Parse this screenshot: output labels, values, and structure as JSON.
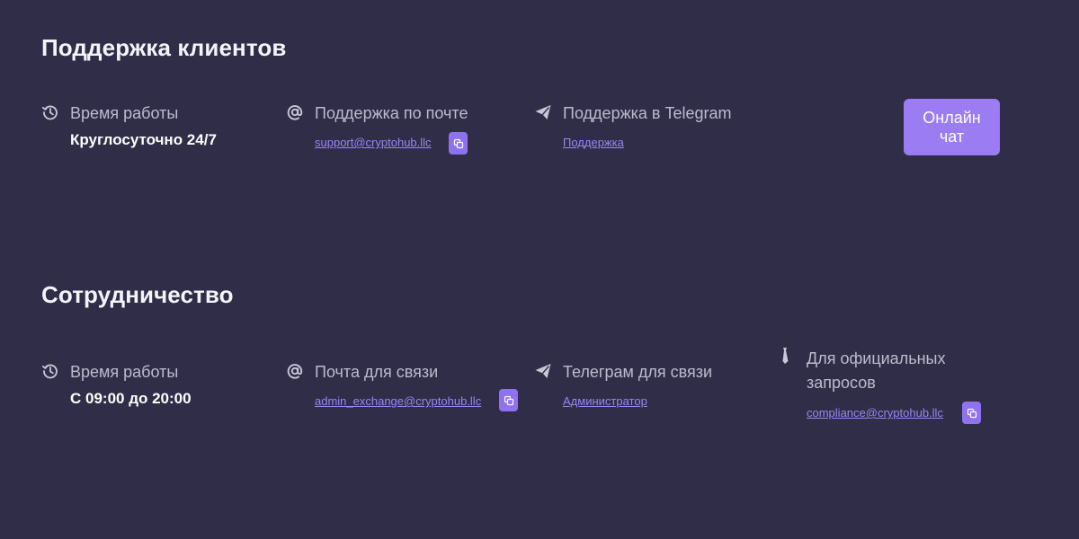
{
  "support": {
    "title": "Поддержка клиентов",
    "hours_label": "Время работы",
    "hours_value": "Круглосуточно 24/7",
    "email_label": "Поддержка по почте",
    "email_link": "support@cryptohub.llc",
    "telegram_label": "Поддержка в Telegram",
    "telegram_link": "Поддержка",
    "chat_button": "Онлайн чат"
  },
  "partnership": {
    "title": "Сотрудничество",
    "hours_label": "Время работы",
    "hours_value": "С 09:00 до 20:00",
    "email_label": "Почта для связи",
    "email_link": "admin_exchange@cryptohub.llc",
    "telegram_label": "Телеграм для связи",
    "telegram_link": "Администратор",
    "official_label": "Для официальных запросов",
    "official_link": "compliance@cryptohub.llc"
  },
  "icons": {
    "hours": "history-clock-icon",
    "email": "at-sign-icon",
    "telegram": "paper-plane-icon",
    "official": "tie-icon",
    "copy": "copy-icon"
  },
  "colors": {
    "background": "#2f2d47",
    "accent": "#9b7cf2",
    "link": "#9b86f2",
    "label": "#bdbbcf"
  }
}
